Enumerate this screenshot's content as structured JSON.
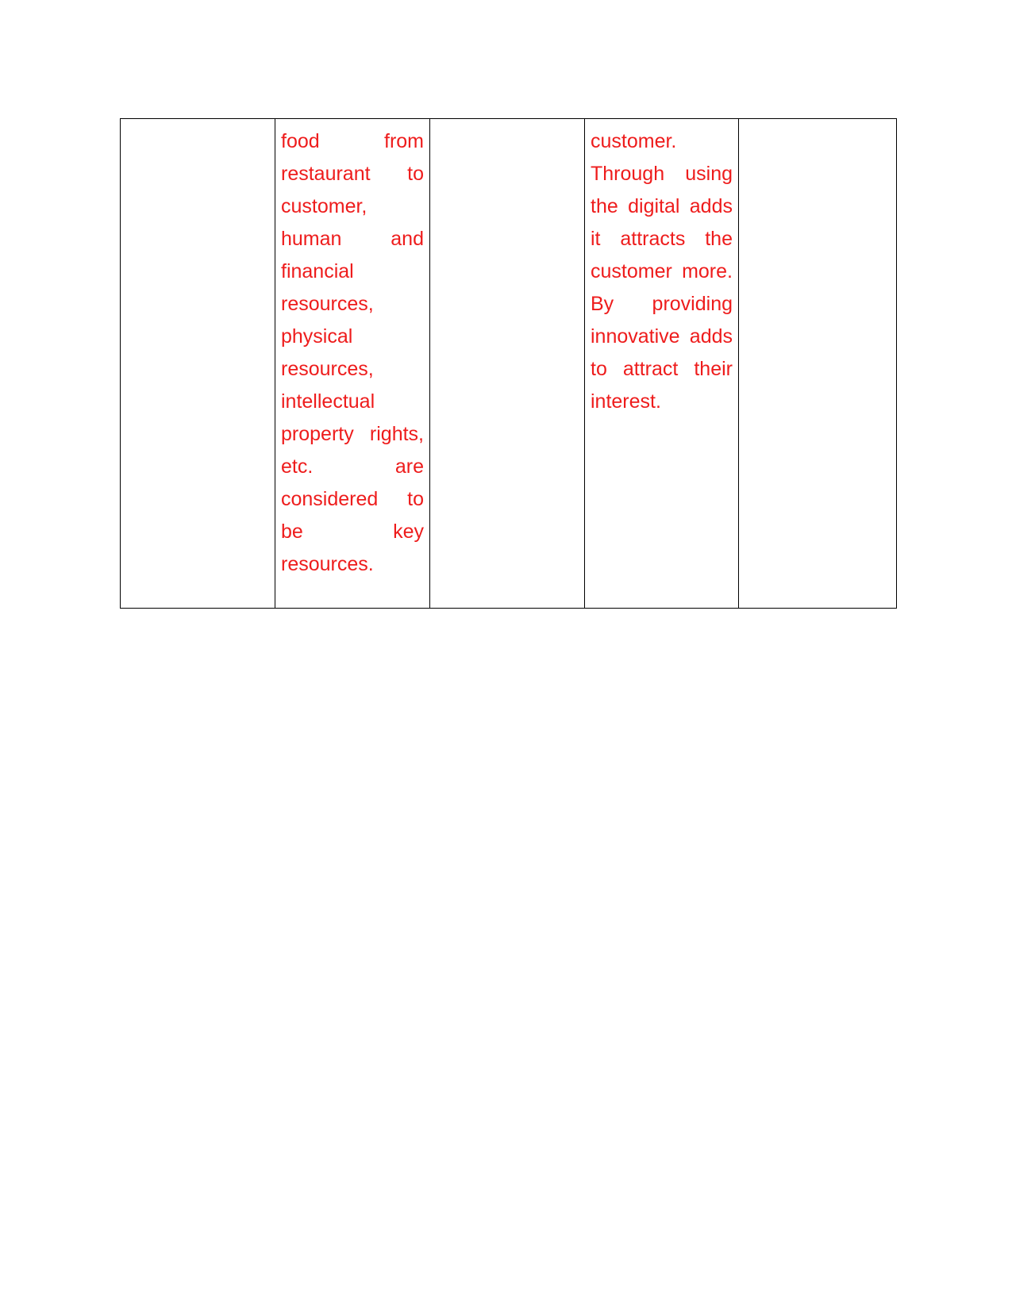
{
  "document": {
    "page_background": "#ffffff",
    "text_color": "#ee1c1c",
    "border_color": "#000000"
  },
  "table": {
    "column_count": 5,
    "row_count": 1,
    "rows": [
      {
        "cells": [
          {
            "name": "cell-col1",
            "text": ""
          },
          {
            "name": "cell-col2",
            "text": "food from restaurant to customer, human and financial resources, physical resources, intellectual property rights, etc. are considered to be key resources."
          },
          {
            "name": "cell-col3",
            "text": ""
          },
          {
            "name": "cell-col4",
            "text": "customer. Through using the digital adds it attracts the customer more. By providing innovative adds to attract their interest."
          },
          {
            "name": "cell-col5",
            "text": ""
          }
        ]
      }
    ]
  }
}
